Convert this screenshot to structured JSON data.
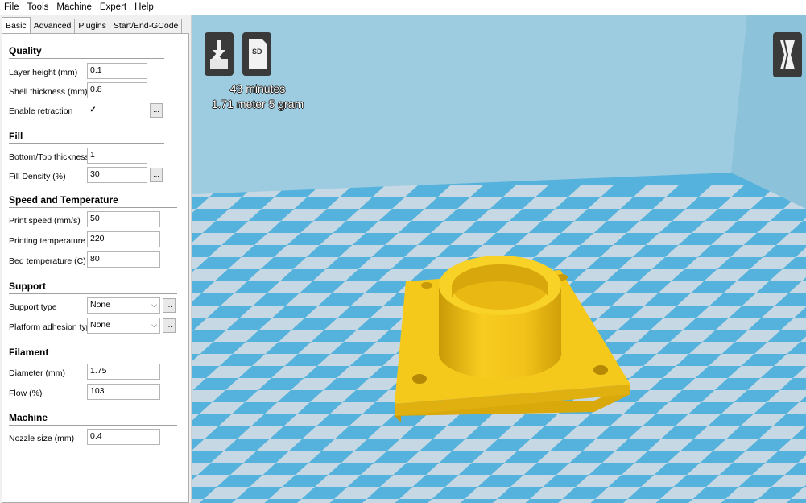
{
  "menubar": {
    "items": [
      "File",
      "Tools",
      "Machine",
      "Expert",
      "Help"
    ]
  },
  "tabs": [
    "Basic",
    "Advanced",
    "Plugins",
    "Start/End-GCode"
  ],
  "sections": {
    "quality": {
      "title": "Quality",
      "layer_height_label": "Layer height (mm)",
      "layer_height_value": "0.1",
      "shell_thickness_label": "Shell thickness (mm)",
      "shell_thickness_value": "0.8",
      "enable_retraction_label": "Enable retraction",
      "enable_retraction_checked": "✓"
    },
    "fill": {
      "title": "Fill",
      "bottom_top_label": "Bottom/Top thickness (mm)",
      "bottom_top_value": "1",
      "fill_density_label": "Fill Density (%)",
      "fill_density_value": "30"
    },
    "speed": {
      "title": "Speed and Temperature",
      "print_speed_label": "Print speed (mm/s)",
      "print_speed_value": "50",
      "print_temp_label": "Printing temperature (C)",
      "print_temp_value": "220",
      "bed_temp_label": "Bed temperature (C)",
      "bed_temp_value": "80"
    },
    "support": {
      "title": "Support",
      "support_type_label": "Support type",
      "support_type_value": "None",
      "adhesion_label": "Platform adhesion type",
      "adhesion_value": "None"
    },
    "filament": {
      "title": "Filament",
      "diameter_label": "Diameter (mm)",
      "diameter_value": "1.75",
      "flow_label": "Flow (%)",
      "flow_value": "103"
    },
    "machine": {
      "title": "Machine",
      "nozzle_label": "Nozzle size (mm)",
      "nozzle_value": "0.4"
    }
  },
  "more_button_label": "...",
  "viewport": {
    "print_time": "43 minutes",
    "print_material": "1.71 meter 5 gram",
    "sd_label": "SD",
    "icons": [
      "load-model-icon",
      "save-sd-icon",
      "view-mode-icon"
    ],
    "colors": {
      "model": "#f5c518",
      "model_shadow": "#d9a90c",
      "floor_light": "#c9d9e3",
      "floor_blue": "#59b3dc",
      "wall": "#9fcde0"
    }
  }
}
